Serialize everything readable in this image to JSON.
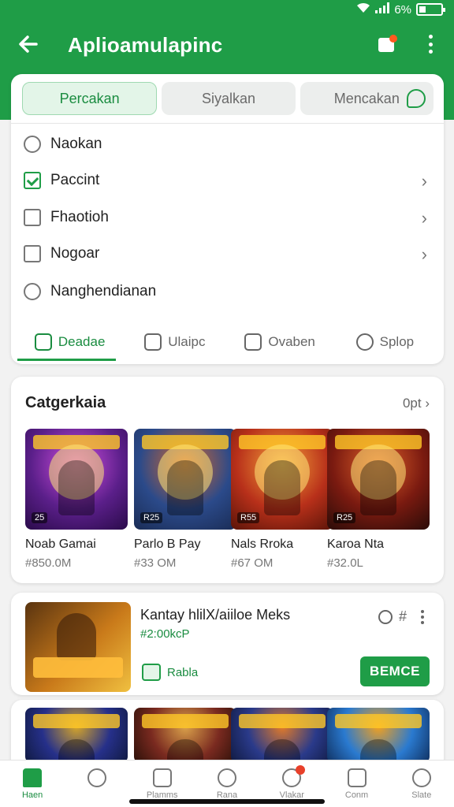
{
  "status_bar": {
    "battery_text": "6%",
    "icons": [
      "wifi-icon",
      "signal-icon",
      "battery-icon"
    ]
  },
  "toolbar": {
    "title": "Aplioamulapinc",
    "back_icon": "arrow-left-icon",
    "notification_icon": "notification-icon",
    "menu_icon": "kebab-menu-icon"
  },
  "colors": {
    "accent": "#1f9d47",
    "accent_light": "#e3f5e8",
    "badge_red": "#e8402a",
    "notif_orange": "#ff5a1f"
  },
  "segments": [
    {
      "label": "Percakan",
      "active": true
    },
    {
      "label": "Siyalkan",
      "active": false
    },
    {
      "label": "Mencakan",
      "active": false,
      "icon": "leaf-icon"
    }
  ],
  "options": [
    {
      "label": "Naokan",
      "type": "radio",
      "checked": false,
      "chevron": false
    },
    {
      "label": "Paccint",
      "type": "checkbox",
      "checked": true,
      "chevron": true
    },
    {
      "label": "Fhaotioh",
      "type": "checkbox",
      "checked": false,
      "chevron": true
    },
    {
      "label": "Nogoar",
      "type": "checkbox",
      "checked": false,
      "chevron": true
    },
    {
      "label": "Nanghendianan",
      "type": "radio",
      "checked": false,
      "chevron": false
    }
  ],
  "subtabs": [
    {
      "label": "Deadae",
      "icon": "home-icon",
      "active": true
    },
    {
      "label": "Ulaipc",
      "icon": "list-icon",
      "active": false
    },
    {
      "label": "Ovaben",
      "icon": "tag-icon",
      "active": false
    },
    {
      "label": "Splop",
      "icon": "clock-icon",
      "active": false
    }
  ],
  "category": {
    "title": "Catgerkaia",
    "more": "0pt",
    "games": [
      {
        "name": "Noab Gamai",
        "price": "#850.0M",
        "badge": "25",
        "colors": [
          "#5b1f8a",
          "#d14fe0",
          "#2a0b4a"
        ]
      },
      {
        "name": "Parlo B Pay",
        "price": "#33 OM",
        "badge": "R25",
        "colors": [
          "#2b4a8a",
          "#d9672a",
          "#1a2c55"
        ]
      },
      {
        "name": "Nals Rroka",
        "price": "#67 OM",
        "badge": "R55",
        "colors": [
          "#b8301a",
          "#f4a23a",
          "#5a1408"
        ]
      },
      {
        "name": "Karoa Nta",
        "price": "#32.0L",
        "badge": "R25",
        "colors": [
          "#7a1a10",
          "#e0612a",
          "#2a0c08"
        ]
      }
    ]
  },
  "featured": {
    "title": "Kantay hlilX/aiiloe Meks",
    "price": "#2:00kcP",
    "tag": "Rabla",
    "button": "BEMCE",
    "icons": [
      "gear-icon",
      "hash-icon",
      "kebab-menu-icon"
    ],
    "hash_text": "#"
  },
  "second_row": [
    {
      "colors": [
        "#26308a",
        "#d4a42a",
        "#101a40"
      ]
    },
    {
      "colors": [
        "#7a2a20",
        "#d9a04a",
        "#2a1008"
      ]
    },
    {
      "colors": [
        "#2a3a8a",
        "#e07a2a",
        "#101a40"
      ]
    },
    {
      "colors": [
        "#2a7ad0",
        "#f0a020",
        "#103060"
      ]
    }
  ],
  "bottom_nav": [
    {
      "label": "Haen",
      "icon": "home-icon",
      "active": true
    },
    {
      "label": "",
      "icon": "search-icon",
      "active": false
    },
    {
      "label": "Plamms",
      "icon": "document-icon",
      "active": false
    },
    {
      "label": "Rana",
      "icon": "flash-icon",
      "active": false
    },
    {
      "label": "Vlakar",
      "icon": "chat-icon",
      "active": false,
      "badge": true
    },
    {
      "label": "Conm",
      "icon": "tv-icon",
      "active": false
    },
    {
      "label": "Slate",
      "icon": "profile-icon",
      "active": false
    }
  ]
}
